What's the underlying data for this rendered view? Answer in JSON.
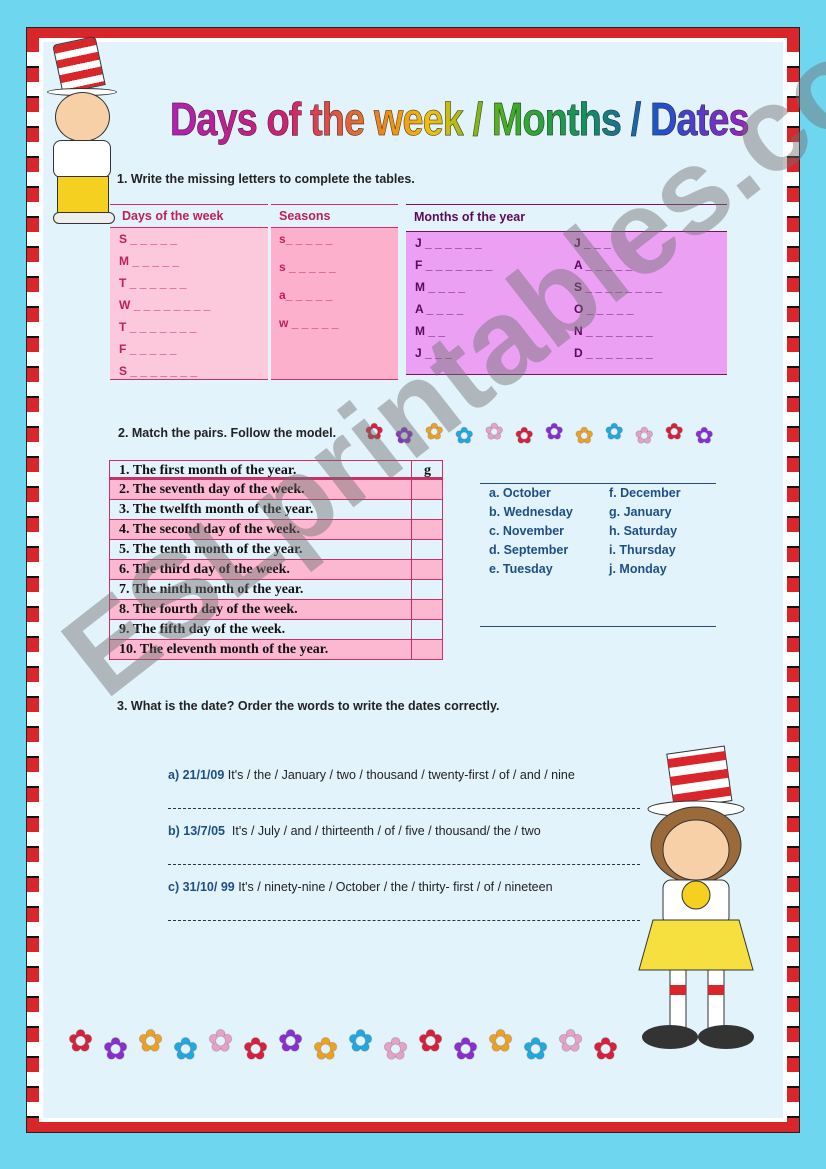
{
  "title": "Days of the week / Months / Dates",
  "section1": {
    "instruction": "1. Write the missing letters to complete the tables.",
    "days": {
      "header": "Days of the week",
      "items": [
        "S _ _ _ _ _",
        "M _ _ _ _ _",
        "T _ _ _ _ _ _",
        "W _ _ _ _ _ _ _ _",
        "T _ _ _ _ _ _ _",
        "F _ _ _ _ _",
        "S _ _ _ _ _ _ _"
      ]
    },
    "seasons": {
      "header": "Seasons",
      "items": [
        "s_ _ _ _ _",
        "s _ _ _ _ _",
        "a_ _ _ _ _",
        "w _ _ _ _ _"
      ]
    },
    "months": {
      "header": "Months of the year",
      "col1": [
        "J _ _ _ _ _ _",
        "F _ _ _ _ _ _ _",
        "M _ _ _ _",
        "A _ _ _ _",
        "M _ _",
        "J _ _ _"
      ],
      "col2": [
        "J _ _ _",
        "A _ _ _ _ _",
        "S _ _ _ _ _ _ _ _",
        "O _ _ _ _ _",
        "N _ _ _ _ _ _ _",
        "D _ _ _ _ _ _ _"
      ]
    }
  },
  "section2": {
    "instruction": "2. Match the pairs. Follow the model.",
    "rows": [
      {
        "text": "1. The first month of the year.",
        "answer": "g"
      },
      {
        "text": " 2. The seventh day of the week.",
        "answer": ""
      },
      {
        "text": "3. The twelfth month of the year.",
        "answer": ""
      },
      {
        "text": "4. The second day of the week.",
        "answer": ""
      },
      {
        "text": "5. The tenth month of the year.",
        "answer": ""
      },
      {
        "text": "6. The third day of the week.",
        "answer": ""
      },
      {
        "text": "7. The ninth month of the year.",
        "answer": ""
      },
      {
        "text": "8. The fourth day of the week.",
        "answer": ""
      },
      {
        "text": "9. The fifth day of the week.",
        "answer": ""
      },
      {
        "text": "10. The eleventh month of the year.",
        "answer": ""
      }
    ],
    "options_col1": [
      "a. October",
      "b. Wednesday",
      "c. November",
      "d. September",
      "e. Tuesday"
    ],
    "options_col2": [
      "f. December",
      "g. January",
      "h. Saturday",
      "i. Thursday",
      "j. Monday"
    ]
  },
  "section3": {
    "instruction": "3. What is the date? Order the words to write the dates correctly.",
    "items": [
      {
        "date": "a) 21/1/09",
        "words": " It's / the / January / two / thousand / twenty-first / of / and / nine"
      },
      {
        "date": "b) 13/7/05",
        "words": "  It's / July / and / thirteenth / of / five / thousand/ the / two"
      },
      {
        "date": "c) 31/10/ 99",
        "words": " It's / ninety-nine / October / the / thirty- first / of / nineteen"
      }
    ]
  },
  "watermark": "ESLprintables.com",
  "colors": {
    "days_bg": "#fcc8dc",
    "seasons_bg": "#fcb0cc",
    "months_bg": "#eca0f4",
    "row_pink": "#fcb8d0",
    "border": "#c8306a",
    "option_blue": "#1d4f86",
    "frame_red": "#d8262b"
  },
  "flower_colors": [
    "#d8203c",
    "#8a2ed0",
    "#f0a020",
    "#20a8e0",
    "#e8a0c8"
  ]
}
